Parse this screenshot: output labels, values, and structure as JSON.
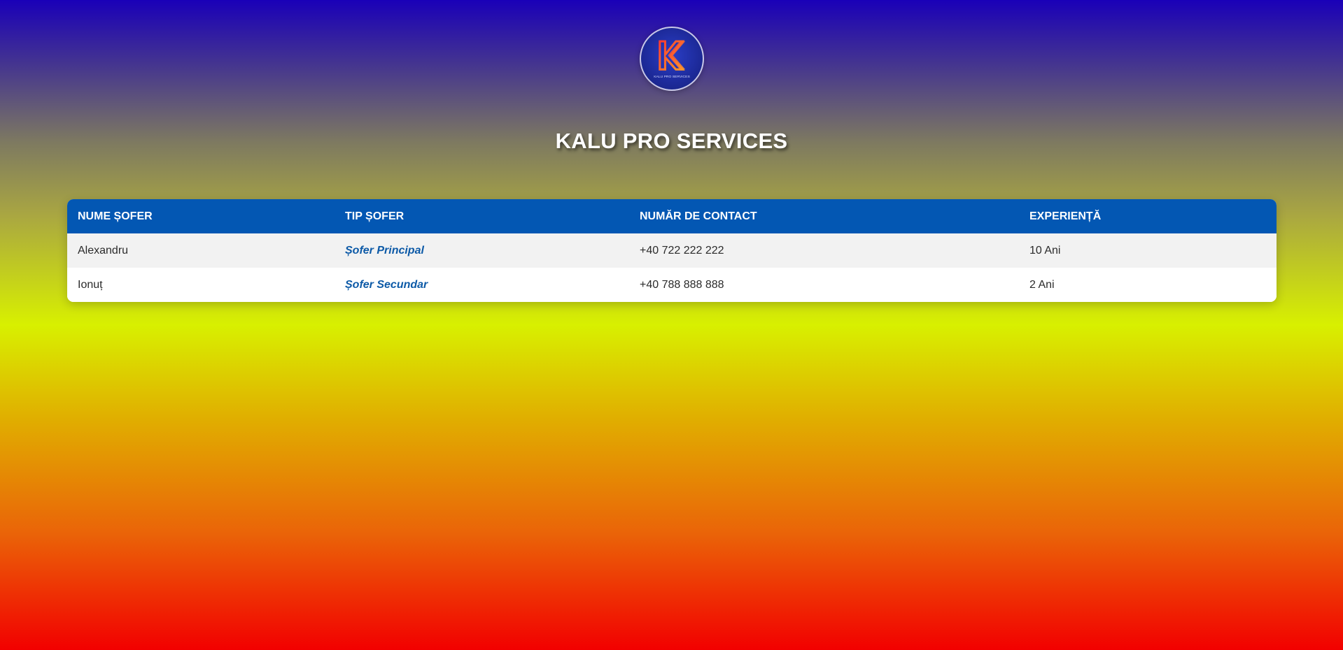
{
  "brand": {
    "logo_text": "KALU PRO SERVICES",
    "logo_letter": "K",
    "title": "KALU PRO SERVICES"
  },
  "table": {
    "headers": [
      "NUME ȘOFER",
      "TIP ȘOFER",
      "NUMĂR DE CONTACT",
      "EXPERIENȚĂ"
    ],
    "rows": [
      {
        "name": "Alexandru",
        "type": "Șofer Principal",
        "phone": "+40 722 222 222",
        "experience": "10 Ani"
      },
      {
        "name": "Ionuț",
        "type": "Șofer Secundar",
        "phone": "+40 788 888 888",
        "experience": "2 Ani"
      }
    ]
  },
  "colors": {
    "header_bg": "#0357b3",
    "accent_link": "#0d5aa7",
    "row_alt": "#f2f2f2",
    "gradient_top": "#1a00b8",
    "gradient_mid": "#d8f000",
    "gradient_bottom": "#f20000"
  }
}
